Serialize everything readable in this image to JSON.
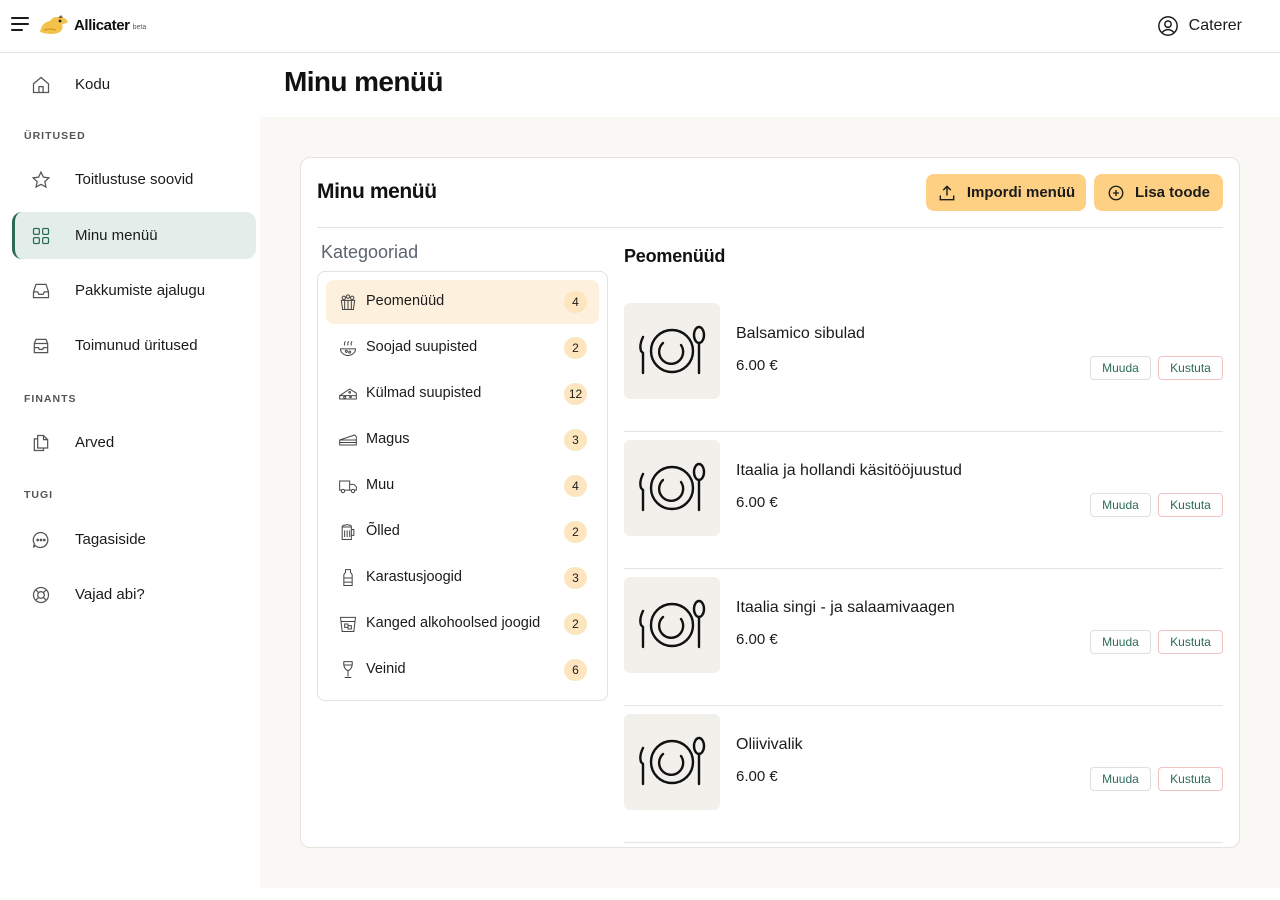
{
  "app": {
    "name": "Allicater",
    "beta": "beta"
  },
  "user": {
    "label": "Caterer"
  },
  "sidebar": {
    "home": "Kodu",
    "sections": {
      "events": "ÜRITUSED",
      "finance": "FINANTS",
      "support": "TUGI"
    },
    "items": {
      "catering": "Toitlustuse soovid",
      "menu": "Minu menüü",
      "offers": "Pakkumiste ajalugu",
      "past": "Toimunud üritused",
      "invoices": "Arved",
      "feedback": "Tagasiside",
      "help": "Vajad abi?"
    }
  },
  "page": {
    "title": "Minu menüü"
  },
  "card": {
    "title": "Minu menüü",
    "import_label": "Impordi menüü",
    "add_label": "Lisa toode"
  },
  "categories": {
    "heading": "Kategooriad",
    "items": [
      {
        "label": "Peomenüüd",
        "count": "4",
        "icon": "party-icon"
      },
      {
        "label": "Soojad suupisted",
        "count": "2",
        "icon": "hot-snack-icon"
      },
      {
        "label": "Külmad suupisted",
        "count": "12",
        "icon": "cheese-icon"
      },
      {
        "label": "Magus",
        "count": "3",
        "icon": "cake-icon"
      },
      {
        "label": "Muu",
        "count": "4",
        "icon": "truck-icon"
      },
      {
        "label": "Õlled",
        "count": "2",
        "icon": "beer-icon"
      },
      {
        "label": "Karastusjoogid",
        "count": "3",
        "icon": "soda-icon"
      },
      {
        "label": "Kanged alkohoolsed joogid",
        "count": "2",
        "icon": "spirits-icon"
      },
      {
        "label": "Veinid",
        "count": "6",
        "icon": "wine-icon"
      }
    ]
  },
  "products": {
    "heading": "Peomenüüd",
    "edit_label": "Muuda",
    "delete_label": "Kustuta",
    "items": [
      {
        "name": "Balsamico sibulad",
        "price": "6.00 €"
      },
      {
        "name": "Itaalia ja hollandi käsitööjuustud",
        "price": "6.00 €"
      },
      {
        "name": "Itaalia singi - ja salaamivaagen",
        "price": "6.00 €"
      },
      {
        "name": "Oliivivalik",
        "price": "6.00 €"
      }
    ]
  },
  "colors": {
    "accent": "#fdd083",
    "active_nav": "#e3eeeb",
    "brand_green": "#2d6a5a"
  }
}
